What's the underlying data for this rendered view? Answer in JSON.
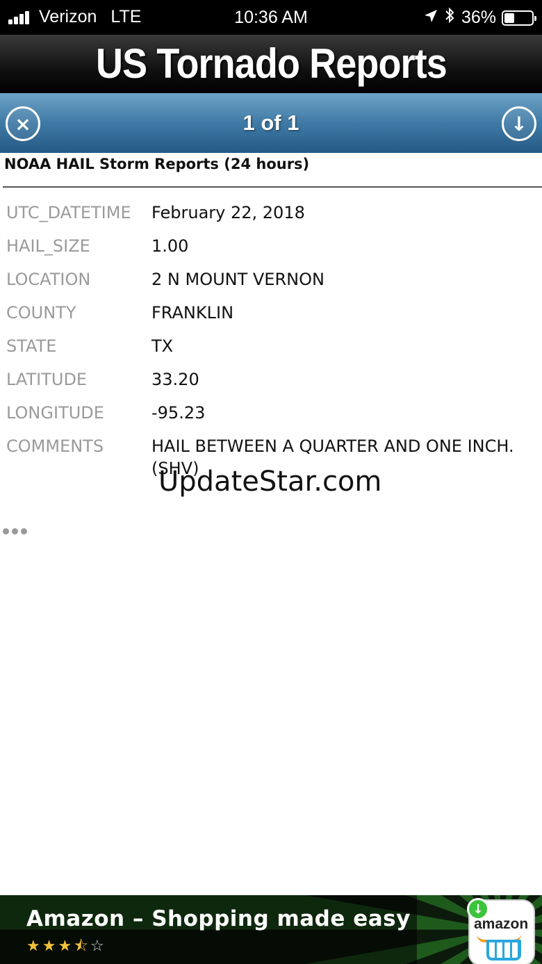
{
  "status_bar": {
    "carrier": "Verizon",
    "network": "LTE",
    "time": "10:36 AM",
    "battery": "36%",
    "icons": [
      "signal-icon",
      "location-arrow-icon",
      "bluetooth-icon",
      "battery-icon"
    ]
  },
  "app": {
    "title": "US Tornado Reports"
  },
  "nav": {
    "counter": "1 of 1",
    "close_icon": "×",
    "next_icon": "↓"
  },
  "report": {
    "heading": "NOAA HAIL Storm Reports (24 hours)",
    "fields": [
      {
        "key": "UTC_DATETIME",
        "value": "February 22, 2018"
      },
      {
        "key": "HAIL_SIZE",
        "value": "1.00"
      },
      {
        "key": "LOCATION",
        "value": "2 N MOUNT VERNON"
      },
      {
        "key": "COUNTY",
        "value": "FRANKLIN"
      },
      {
        "key": "STATE",
        "value": "TX"
      },
      {
        "key": "LATITUDE",
        "value": "33.20"
      },
      {
        "key": "LONGITUDE",
        "value": "-95.23"
      },
      {
        "key": "COMMENTS",
        "value": "HAIL BETWEEN A QUARTER AND ONE INCH. (SHV)"
      }
    ]
  },
  "watermark": "UpdateStar.com",
  "ad": {
    "title": "Amazon – Shopping made easy",
    "rating": 3.5,
    "stars": "★★★",
    "half_star": "⯪",
    "empty_star": "☆",
    "icon_word": "amazon",
    "badge_icon": "↓"
  }
}
